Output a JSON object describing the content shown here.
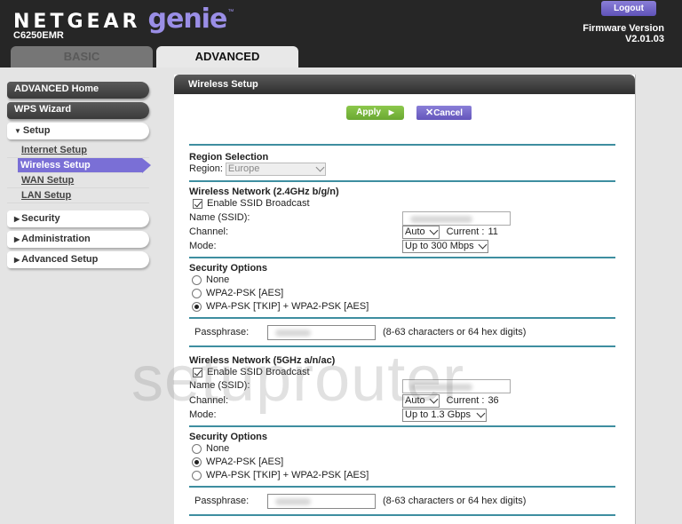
{
  "header": {
    "brand": "NETGEAR",
    "product": "genie",
    "trademark": "™",
    "model": "C6250EMR",
    "logout_label": "Logout",
    "firmware_label": "Firmware Version",
    "firmware_version": "V2.01.03",
    "tabs": [
      {
        "label": "BASIC",
        "active": false
      },
      {
        "label": "ADVANCED",
        "active": true
      }
    ]
  },
  "sidebar": {
    "advanced_home": "ADVANCED Home",
    "wps_wizard": "WPS Wizard",
    "setup": "Setup",
    "setup_items": [
      "Internet Setup",
      "Wireless Setup",
      "WAN Setup",
      "LAN Setup"
    ],
    "active_item": "Wireless Setup",
    "security": "Security",
    "administration": "Administration",
    "advanced_setup": "Advanced Setup"
  },
  "panel": {
    "title": "Wireless Setup",
    "apply_label": "Apply",
    "cancel_label": "Cancel",
    "region": {
      "title": "Region Selection",
      "label": "Region:",
      "value": "Europe"
    },
    "net24": {
      "title": "Wireless Network (2.4GHz b/g/n)",
      "ssid_broadcast_label": "Enable SSID Broadcast",
      "ssid_broadcast": true,
      "name_label": "Name (SSID):",
      "channel_label": "Channel:",
      "channel_value": "Auto",
      "current_label": "Current :",
      "current_value": "11",
      "mode_label": "Mode:",
      "mode_value": "Up to 300 Mbps",
      "security_title": "Security Options",
      "security_options": [
        "None",
        "WPA2-PSK [AES]",
        "WPA-PSK [TKIP] + WPA2-PSK [AES]"
      ],
      "security_selected": 2,
      "passphrase_label": "Passphrase:",
      "passphrase_hint": "(8-63 characters or 64 hex digits)"
    },
    "net5": {
      "title": "Wireless Network (5GHz a/n/ac)",
      "ssid_broadcast_label": "Enable SSID Broadcast",
      "ssid_broadcast": true,
      "name_label": "Name (SSID):",
      "channel_label": "Channel:",
      "channel_value": "Auto",
      "current_label": "Current :",
      "current_value": "36",
      "mode_label": "Mode:",
      "mode_value": "Up to 1.3 Gbps",
      "security_title": "Security Options",
      "security_options": [
        "None",
        "WPA2-PSK [AES]",
        "WPA-PSK [TKIP] + WPA2-PSK [AES]"
      ],
      "security_selected": 1,
      "passphrase_label": "Passphrase:",
      "passphrase_hint": "(8-63 characters or 64 hex digits)"
    }
  },
  "watermark": "setuprouter",
  "colors": {
    "accent_purple": "#7a6fd6",
    "apply_green": "#7ab840",
    "rule_teal": "#3e8ea0",
    "header_bg": "#262626"
  }
}
